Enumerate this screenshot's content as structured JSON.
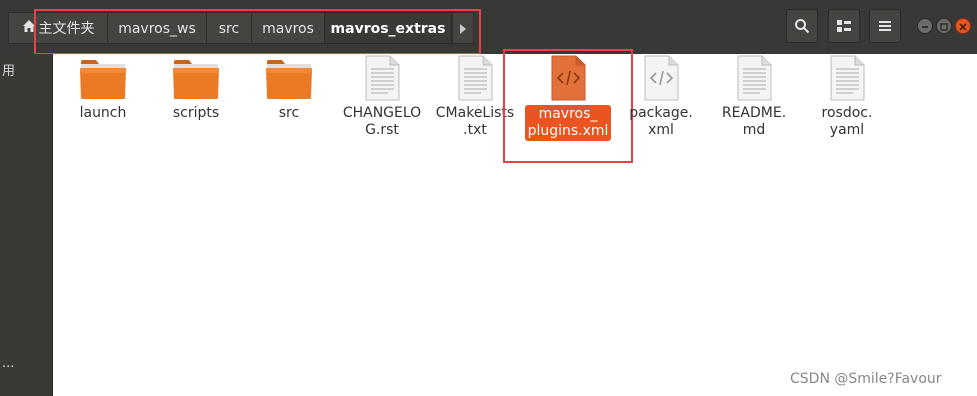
{
  "breadcrumb": {
    "items": [
      {
        "label": "主文件夹"
      },
      {
        "label": "mavros_ws"
      },
      {
        "label": "src"
      },
      {
        "label": "mavros"
      },
      {
        "label": "mavros_extras"
      }
    ]
  },
  "sidebar": {
    "top_char": "用",
    "bottom_text": "..."
  },
  "files": [
    {
      "name": "launch",
      "type": "folder"
    },
    {
      "name": "scripts",
      "type": "folder"
    },
    {
      "name": "src",
      "type": "folder"
    },
    {
      "name": "CHANGELOG.rst",
      "type": "text"
    },
    {
      "name": "CMakeLists.txt",
      "type": "text"
    },
    {
      "name": "mavros_plugins.xml",
      "type": "xml",
      "selected": true
    },
    {
      "name": "package.xml",
      "type": "xml"
    },
    {
      "name": "README.md",
      "type": "text"
    },
    {
      "name": "rosdoc.yaml",
      "type": "text"
    }
  ],
  "labels": {
    "changelog_l1": "CHANGELO",
    "changelog_l2": "G.rst",
    "cmake_l1": "CMakeLists",
    "cmake_l2": ".txt",
    "plugins_l1": "mavros_",
    "plugins_l2": "plugins.xml",
    "package_l1": "package.",
    "package_l2": "xml",
    "readme_l1": "README.",
    "readme_l2": "md",
    "rosdoc_l1": "rosdoc.",
    "rosdoc_l2": "yaml"
  },
  "watermark": "CSDN @Smile?Favour",
  "colors": {
    "header_bg": "#393836",
    "folder_orange": "#e9711c",
    "selection": "#e95420",
    "annotation_red": "#e8404a"
  }
}
